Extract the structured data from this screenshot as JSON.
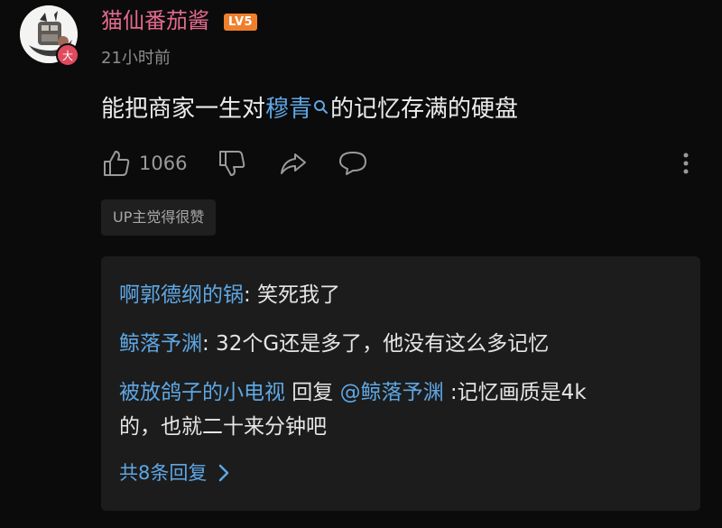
{
  "comment": {
    "username": "猫仙番茄酱",
    "level": "LV5",
    "avatar_badge": "大",
    "timestamp": "21小时前",
    "text_before": "能把商家一生对",
    "text_link": "穆青",
    "text_after": "的记忆存满的硬盘",
    "like_count": "1066",
    "up_tag": "UP主觉得很赞",
    "accent_color": "#e36a8e",
    "link_color": "#5ea7e4"
  },
  "actions": {
    "like_icon": "thumbs-up-icon",
    "dislike_icon": "thumbs-down-icon",
    "share_icon": "share-icon",
    "reply_icon": "comment-bubble-icon",
    "more_icon": "more-vertical-icon"
  },
  "replies": [
    {
      "nick": "啊郭德纲的锅",
      "text": ": 笑死我了"
    },
    {
      "nick": "鲸落予渊",
      "text": ": 32个G还是多了，他没有这么多记忆"
    },
    {
      "nick": "被放鸽子的小电视",
      "reply_word": " 回复 ",
      "mention": "@鲸落予渊",
      "text_line1": " :记忆画质是4k",
      "text_line2": "的，也就二十来分钟吧"
    }
  ],
  "more_replies": "共8条回复"
}
